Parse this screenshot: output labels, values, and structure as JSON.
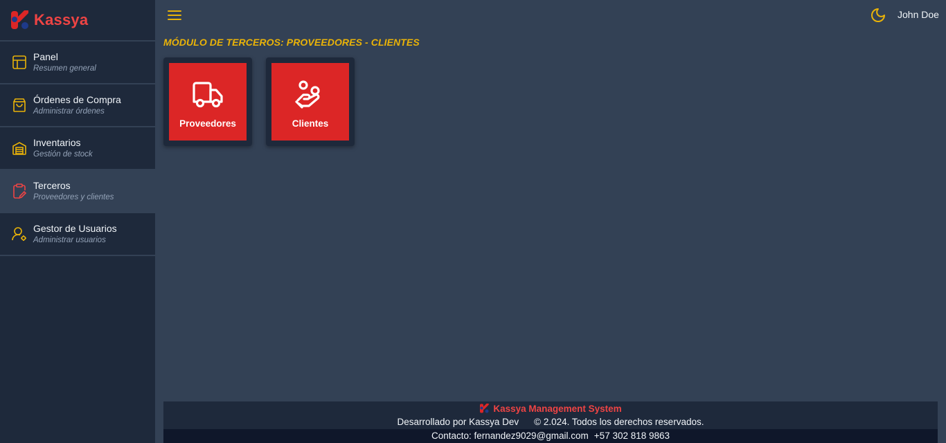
{
  "brand": {
    "name": "Kassya"
  },
  "sidebar": {
    "items": [
      {
        "label": "Panel",
        "sub": "Resumen general",
        "icon": "layout-icon"
      },
      {
        "label": "Órdenes de Compra",
        "sub": "Administrar órdenes",
        "icon": "shopping-bag-icon"
      },
      {
        "label": "Inventarios",
        "sub": "Gestión de stock",
        "icon": "warehouse-icon"
      },
      {
        "label": "Terceros",
        "sub": "Proveedores y clientes",
        "icon": "clipboard-icon",
        "active": true
      },
      {
        "label": "Gestor de Usuarios",
        "sub": "Administrar usuarios",
        "icon": "user-gear-icon"
      }
    ]
  },
  "header": {
    "user": "John Doe"
  },
  "main": {
    "title": "MÓDULO DE TERCEROS: PROVEEDORES - CLIENTES",
    "cards": [
      {
        "label": "Proveedores",
        "icon": "truck-icon"
      },
      {
        "label": "Clientes",
        "icon": "hand-coins-icon"
      }
    ]
  },
  "footer": {
    "title": "Kassya Management System",
    "developer": "Desarrollado por Kassya Dev",
    "copyright": "© 2.024. Todos los derechos reservados.",
    "contact_email": "Contacto: fernandez9029@gmail.com",
    "contact_phone": "+57 302 818 9863"
  },
  "colors": {
    "accent": "#eab308",
    "brand": "#ef4444",
    "card": "#dc2626",
    "sidebar": "#1e293b",
    "background": "#334155"
  }
}
